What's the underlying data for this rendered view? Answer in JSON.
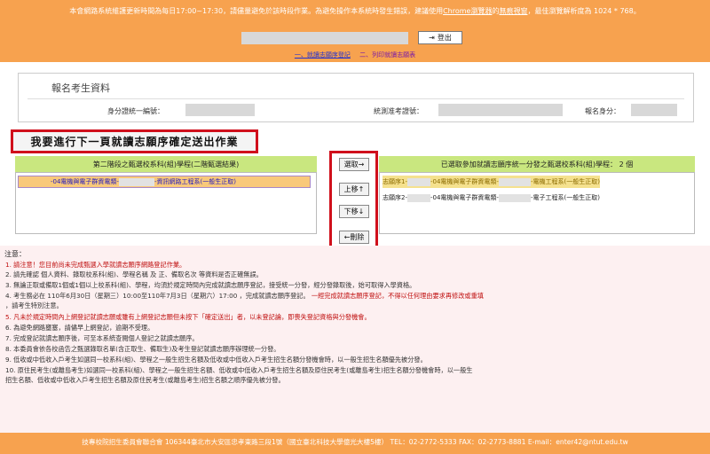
{
  "banner": {
    "notice_before": "本會網路系統維護更新時間為每日17:00~17:30，請儘量避免於該時段作業。為避免操作本系統時發生錯誤，建議使用",
    "browser_link": "Chrome瀏覽器",
    "notice_middle": "的",
    "privacy_link": "無痕視窗",
    "notice_after": "，最佳瀏覽解析度為 1024 * 768。",
    "logout_label": "登出"
  },
  "steps": {
    "step1": "一、就讀志願序登記",
    "step2": "二、列印就讀志願表"
  },
  "profile": {
    "title": "報名考生資料",
    "id_label": "身分證統一編號：",
    "exam_no_label": "統測准考證號：",
    "identity_label": "報名身分："
  },
  "submit_button": "我要進行下一頁就讀志願序確定送出作業",
  "candidates": {
    "header": "第二階段之甄選校系科(組)學程(二階甄選結果)",
    "items": [
      {
        "prefix": "-04電機與電子群資電類-",
        "suffix": "-資訊網路工程系(一般生正取)"
      }
    ]
  },
  "controls": {
    "select": "選取→",
    "up": "上移↑",
    "down": "下移↓",
    "delete": "←刪除"
  },
  "selected": {
    "header": "已選取參加就讀志願序統一分發之甄選校系科(組)學程：",
    "count": "2 個",
    "items": [
      {
        "prefix": "志願序1-",
        "mid": "-04電機與電子群資電類-",
        "suffix": "-電機工程系(一般生正取)"
      },
      {
        "prefix": "志願序2-",
        "mid": "-04電機與電子群資電類-",
        "suffix": "-電子工程系(一般生正取)"
      }
    ]
  },
  "notes": {
    "title": "注意：",
    "items": [
      "1. 請注意！您目前尚未完成甄選入學就讀志願序網路登記作業。",
      "2. 請先確認 個人資料、錄取校系科(組)、學程名稱 及 正、備取名次 等資料是否正確無誤。",
      "3. 無論正取或備取1個或1個以上校系科(組)、學程，均須於規定時間內完成就讀志願序登記，接受統一分發，經分發錄取後，始可取得入學資格。",
      "4. 考生務必在 110年6月30日（星期三）10:00至110年7月3日（星期六）17:00 ，完成就讀志願序登記。",
      "   一經完成就讀志願序登記，不得以任何理由要求再修改或重填",
      "   ，請考生特別注意。",
      "5. 凡未於規定時間內上網登記就讀志願或雖有上網登記志願但未按下「確定送出」者，以未登記論，即喪失登記資格與分發機會。",
      "6. 為避免網路壅塞，請儘早上網登記，逾期不受理。",
      "7. 完成登記就讀志願序後，可至本系統查閱個人登記之就讀志願序。",
      "8. 本委員會依各校函告之甄選錄取名單(含正取生、備取生)及考生登記就讀志願序辦理統一分發。",
      "9. 低收或中低收入戶考生如選同一校系科(組)、學程之一般生招生名額及低收或中低收入戶考生招生名額分發機會時，以一般生招生名額優先被分發。",
      "10. 原住民考生(或離島考生)如選同一校系科(組)、學程之一般生招生名額、低收或中低收入戶考生招生名額及原住民考生(或離島考生)招生名額分發機會時，以一般生",
      "    招生名額、低收或中低收入戶考生招生名額及原住民考生(或離島考生)招生名額之順序優先被分發。"
    ]
  },
  "footer": "技專校院招生委員會聯合會 106344臺北市大安區忠孝東路三段1號（國立臺北科技大學億光大樓5樓） TEL：02-2772-5333 FAX：02-2773-8881 E-mail：enter42@ntut.edu.tw"
}
